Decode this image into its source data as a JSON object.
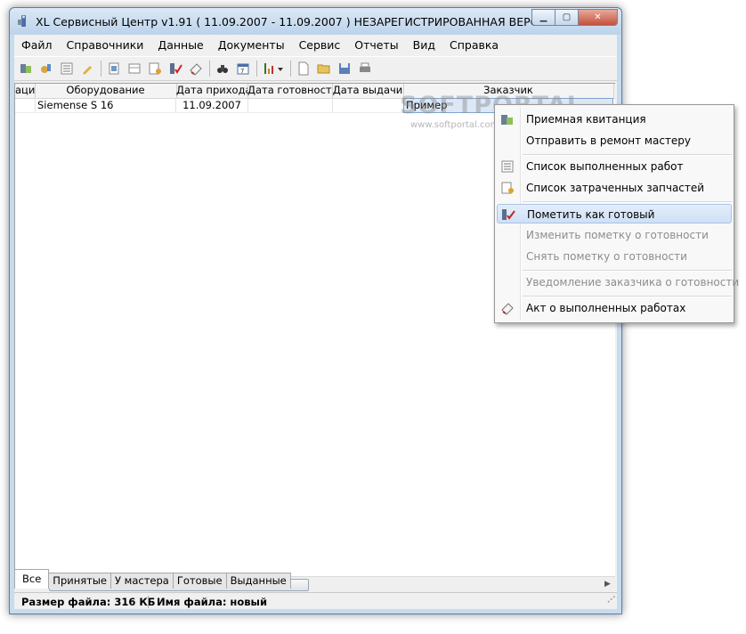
{
  "window": {
    "title": "XL Сервисный Центр v1.91   ( 11.09.2007 - 11.09.2007 ) НЕЗАРЕГИСТРИРОВАННАЯ ВЕРСИЯ",
    "minimize": "▁",
    "maximize": "▢",
    "close": "✕"
  },
  "menubar": {
    "items": [
      {
        "label": "Файл"
      },
      {
        "label": "Справочники"
      },
      {
        "label": "Данные"
      },
      {
        "label": "Документы"
      },
      {
        "label": "Сервис"
      },
      {
        "label": "Отчеты"
      },
      {
        "label": "Вид"
      },
      {
        "label": "Справка"
      }
    ]
  },
  "toolbar": {
    "icons": [
      "receipt-icon",
      "paint-icon",
      "list-icon",
      "pencil-icon",
      "doc-icon",
      "table-icon",
      "parts-icon",
      "mark-done-icon",
      "act-icon",
      "binoculars-icon",
      "calendar-icon",
      "sort-icon",
      "new-doc-icon",
      "open-folder-icon",
      "save-icon",
      "print-icon"
    ]
  },
  "watermark": {
    "main": "SOFTPORTAL",
    "sub": "www.softportal.com"
  },
  "grid": {
    "columns": [
      {
        "label": "ация"
      },
      {
        "label": "Оборудование"
      },
      {
        "label": "Дата прихода"
      },
      {
        "label": "Дата готовности"
      },
      {
        "label": "Дата выдачи"
      },
      {
        "label": "Заказчик"
      }
    ],
    "rows": [
      {
        "cells": [
          "",
          "Siemense S 16",
          "11.09.2007",
          "",
          "",
          "Пример"
        ]
      }
    ]
  },
  "scrollbar": {
    "left": "◀",
    "right": "▶",
    "thumb": "III"
  },
  "tabs": [
    {
      "label": "Все",
      "active": true
    },
    {
      "label": "Принятые"
    },
    {
      "label": "У мастера"
    },
    {
      "label": "Готовые"
    },
    {
      "label": "Выданные"
    }
  ],
  "status": {
    "file_size": "Размер файла: 316 КБ",
    "file_name": "Имя файла: новый"
  },
  "context_menu": {
    "items": [
      {
        "label": "Приемная квитанция",
        "icon": "receipt-icon"
      },
      {
        "label": "Отправить в ремонт мастеру"
      },
      {
        "label": "Список выполненных работ",
        "icon": "list-icon"
      },
      {
        "label": "Список затраченных запчастей",
        "icon": "parts-icon"
      },
      {
        "label": "Пометить как готовый",
        "icon": "mark-done-icon",
        "highlighted": true
      },
      {
        "label": "Изменить пометку о готовности",
        "disabled": true
      },
      {
        "label": "Снять пометку о готовности",
        "disabled": true
      },
      {
        "label": "Уведомление заказчика о готовности",
        "disabled": true
      },
      {
        "label": "Акт о выполненных работах",
        "icon": "act-icon"
      }
    ]
  }
}
